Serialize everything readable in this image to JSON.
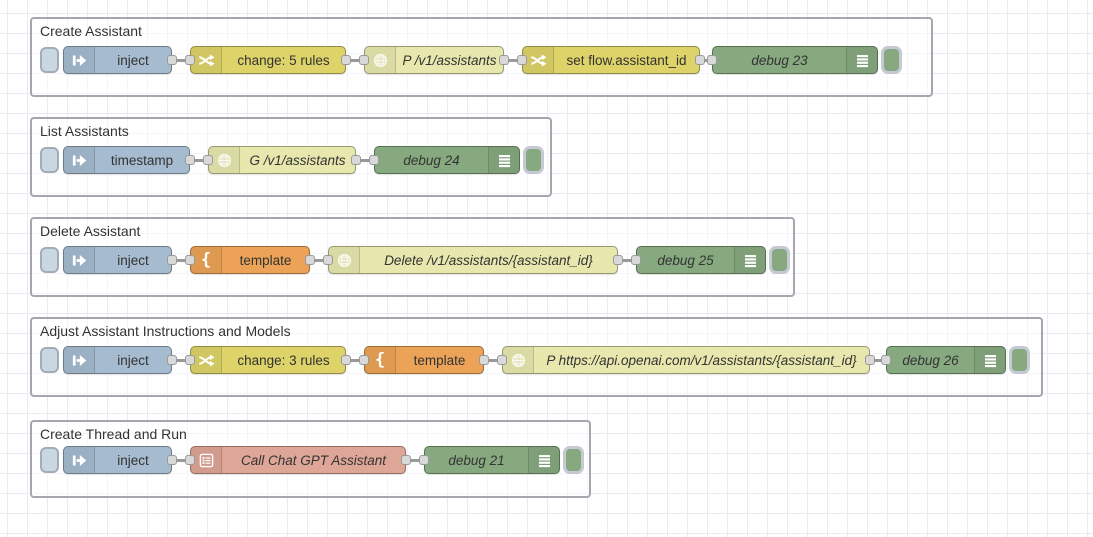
{
  "app": "node-red-flow-editor",
  "palette_colors": {
    "inject": "#a6bbcf",
    "change": "#ddd369",
    "http_request": "#e7e7ae",
    "template": "#eca357",
    "debug": "#87a980",
    "chatgpt_subflow": "#dea696",
    "wire": "#999999",
    "port": "#d9d9d9",
    "group_border": "#a6a6af",
    "grid": "#e9ebf3"
  },
  "groups": [
    {
      "label": "Create Assistant",
      "nodes": [
        {
          "type": "inject",
          "label": "inject"
        },
        {
          "type": "change",
          "label": "change: 5 rules"
        },
        {
          "type": "http request",
          "label": "P /v1/assistants"
        },
        {
          "type": "change",
          "label": "set flow.assistant_id"
        },
        {
          "type": "debug",
          "label": "debug 23"
        }
      ]
    },
    {
      "label": "List Assistants",
      "nodes": [
        {
          "type": "inject",
          "label": "timestamp"
        },
        {
          "type": "http request",
          "label": "G /v1/assistants"
        },
        {
          "type": "debug",
          "label": "debug 24"
        }
      ]
    },
    {
      "label": "Delete Assistant",
      "nodes": [
        {
          "type": "inject",
          "label": "inject"
        },
        {
          "type": "template",
          "label": "template"
        },
        {
          "type": "http request",
          "label": "Delete /v1/assistants/{assistant_id}"
        },
        {
          "type": "debug",
          "label": "debug 25"
        }
      ]
    },
    {
      "label": "Adjust Assistant Instructions and Models",
      "nodes": [
        {
          "type": "inject",
          "label": "inject"
        },
        {
          "type": "change",
          "label": "change: 3 rules"
        },
        {
          "type": "template",
          "label": "template"
        },
        {
          "type": "http request",
          "label": "P https://api.openai.com/v1/assistants/{assistant_id}"
        },
        {
          "type": "debug",
          "label": "debug 26"
        }
      ]
    },
    {
      "label": "Create Thread and Run",
      "nodes": [
        {
          "type": "inject",
          "label": "inject"
        },
        {
          "type": "subflow",
          "label": "Call Chat GPT Assistant"
        },
        {
          "type": "debug",
          "label": "debug 21"
        }
      ]
    }
  ],
  "icons": {
    "inject": "inject-arrow-icon",
    "change": "shuffle-icon",
    "http": "globe-icon",
    "template": "curly-brace-icon",
    "debug": "list-lines-icon",
    "subflow": "form-lines-icon"
  }
}
